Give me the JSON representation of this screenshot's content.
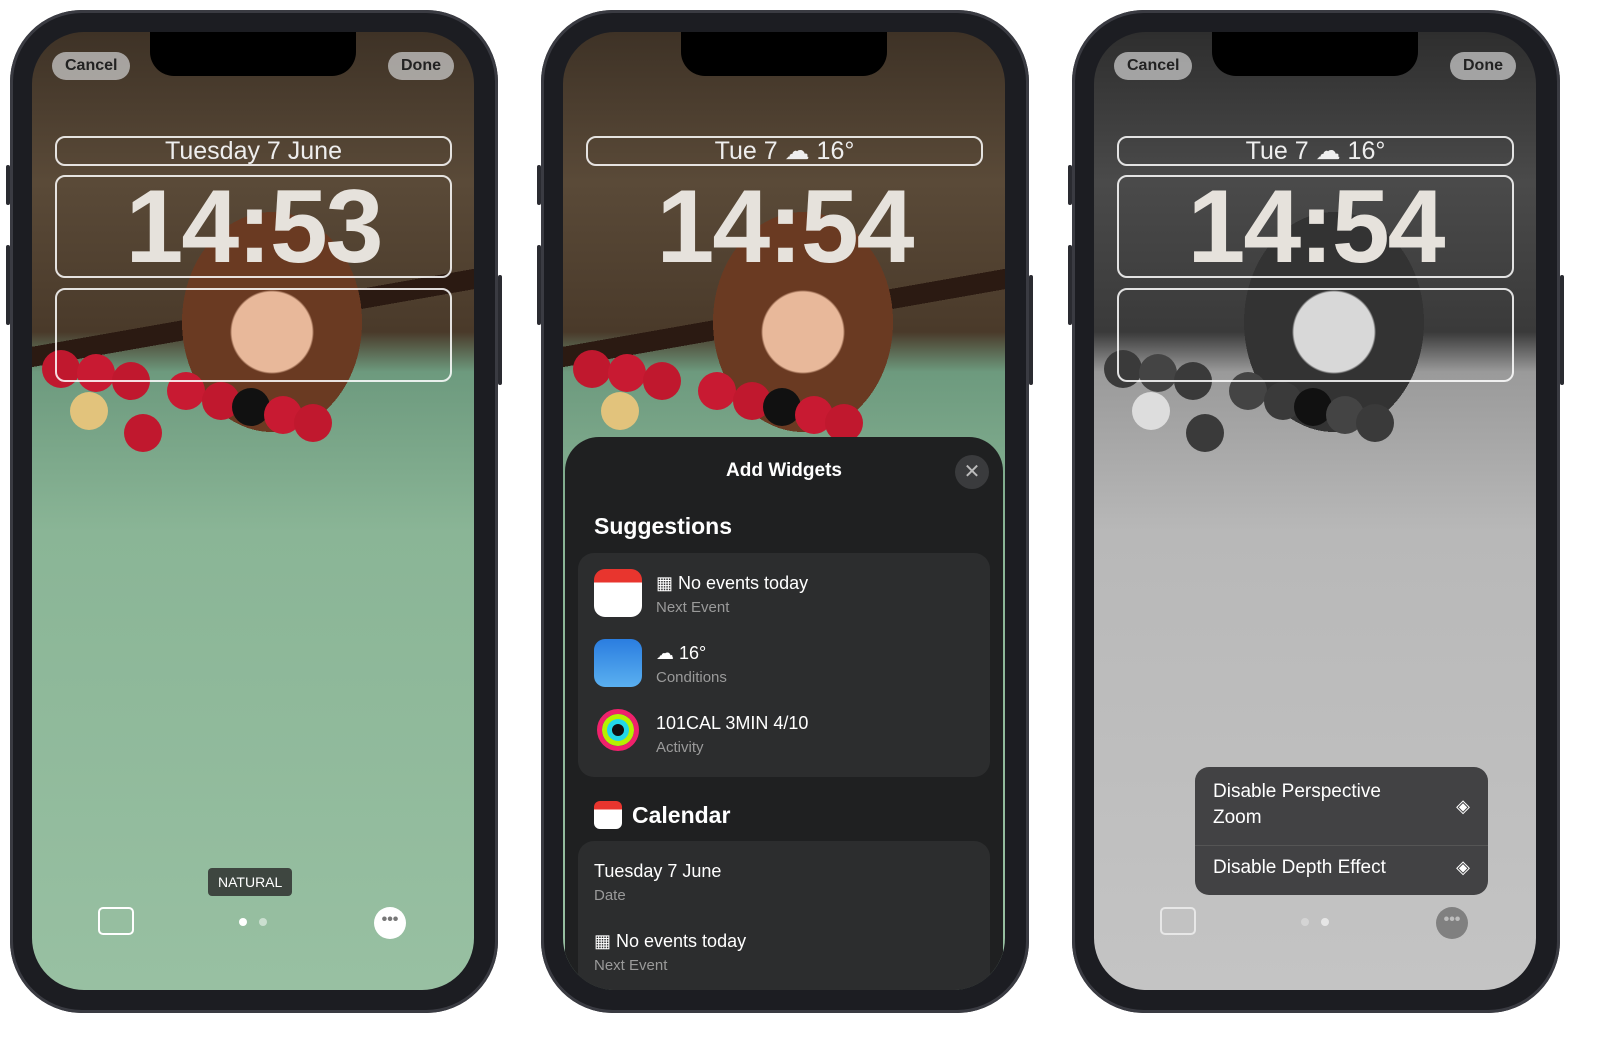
{
  "phone1": {
    "cancel": "Cancel",
    "done": "Done",
    "date": "Tuesday 7 June",
    "time": "14:53",
    "filter_label": "NATURAL",
    "page_dots": 2,
    "active_page": 1
  },
  "phone2": {
    "date": "Tue 7",
    "weather_temp": "16°",
    "time": "14:54",
    "sheet": {
      "title": "Add Widgets",
      "close_icon": "close-icon",
      "suggestions_heading": "Suggestions",
      "suggestions": [
        {
          "icon": "calendar-app-icon",
          "title": "No events today",
          "subtitle": "Next Event"
        },
        {
          "icon": "weather-app-icon",
          "title": "16°",
          "subtitle": "Conditions"
        },
        {
          "icon": "activity-app-icon",
          "title": "101CAL 3MIN 4/10",
          "subtitle": "Activity"
        }
      ],
      "calendar_heading": "Calendar",
      "calendar_items": [
        {
          "title": "Tuesday 7 June",
          "subtitle": "Date"
        },
        {
          "title": "No events today",
          "subtitle": "Next Event"
        }
      ]
    }
  },
  "phone3": {
    "cancel": "Cancel",
    "done": "Done",
    "date": "Tue 7",
    "weather_temp": "16°",
    "time": "14:54",
    "menu": [
      {
        "label": "Disable Perspective Zoom",
        "icon": "layers-icon"
      },
      {
        "label": "Disable Depth Effect",
        "icon": "layers-icon"
      }
    ],
    "active_page": 2
  }
}
